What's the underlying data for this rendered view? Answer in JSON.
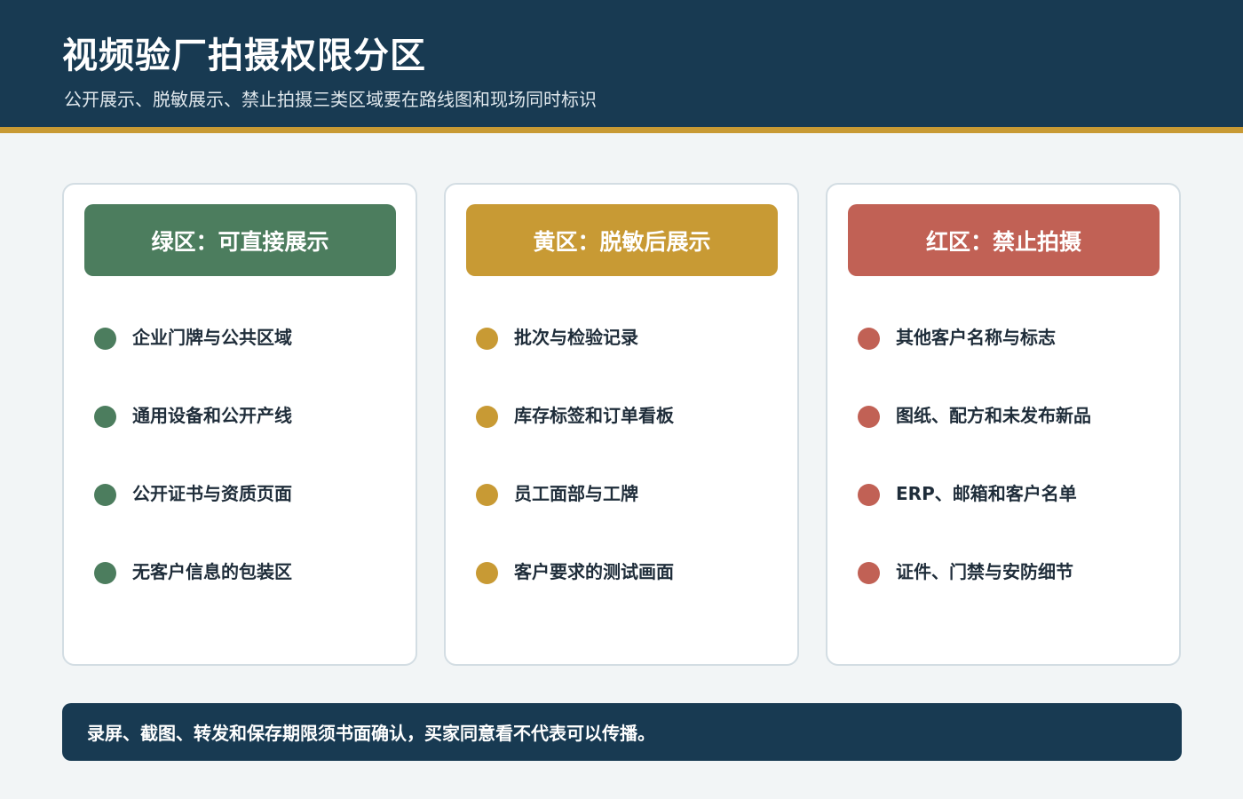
{
  "header": {
    "title": "视频验厂拍摄权限分区",
    "subtitle": "公开展示、脱敏展示、禁止拍摄三类区域要在路线图和现场同时标识"
  },
  "zones": [
    {
      "label": "绿区：可直接展示",
      "color": "#4c7d5e",
      "items": [
        "企业门牌与公共区域",
        "通用设备和公开产线",
        "公开证书与资质页面",
        "无客户信息的包装区"
      ]
    },
    {
      "label": "黄区：脱敏后展示",
      "color": "#c89a34",
      "items": [
        "批次与检验记录",
        "库存标签和订单看板",
        "员工面部与工牌",
        "客户要求的测试画面"
      ]
    },
    {
      "label": "红区：禁止拍摄",
      "color": "#c16155",
      "items": [
        "其他客户名称与标志",
        "图纸、配方和未发布新品",
        "ERP、邮箱和客户名单",
        "证件、门禁与安防细节"
      ]
    }
  ],
  "footer": {
    "note": "录屏、截图、转发和保存期限须书面确认，买家同意看不代表可以传播。"
  },
  "colors": {
    "header_bg": "#183a52",
    "accent_gold": "#c89a34",
    "page_bg": "#f2f5f6"
  }
}
